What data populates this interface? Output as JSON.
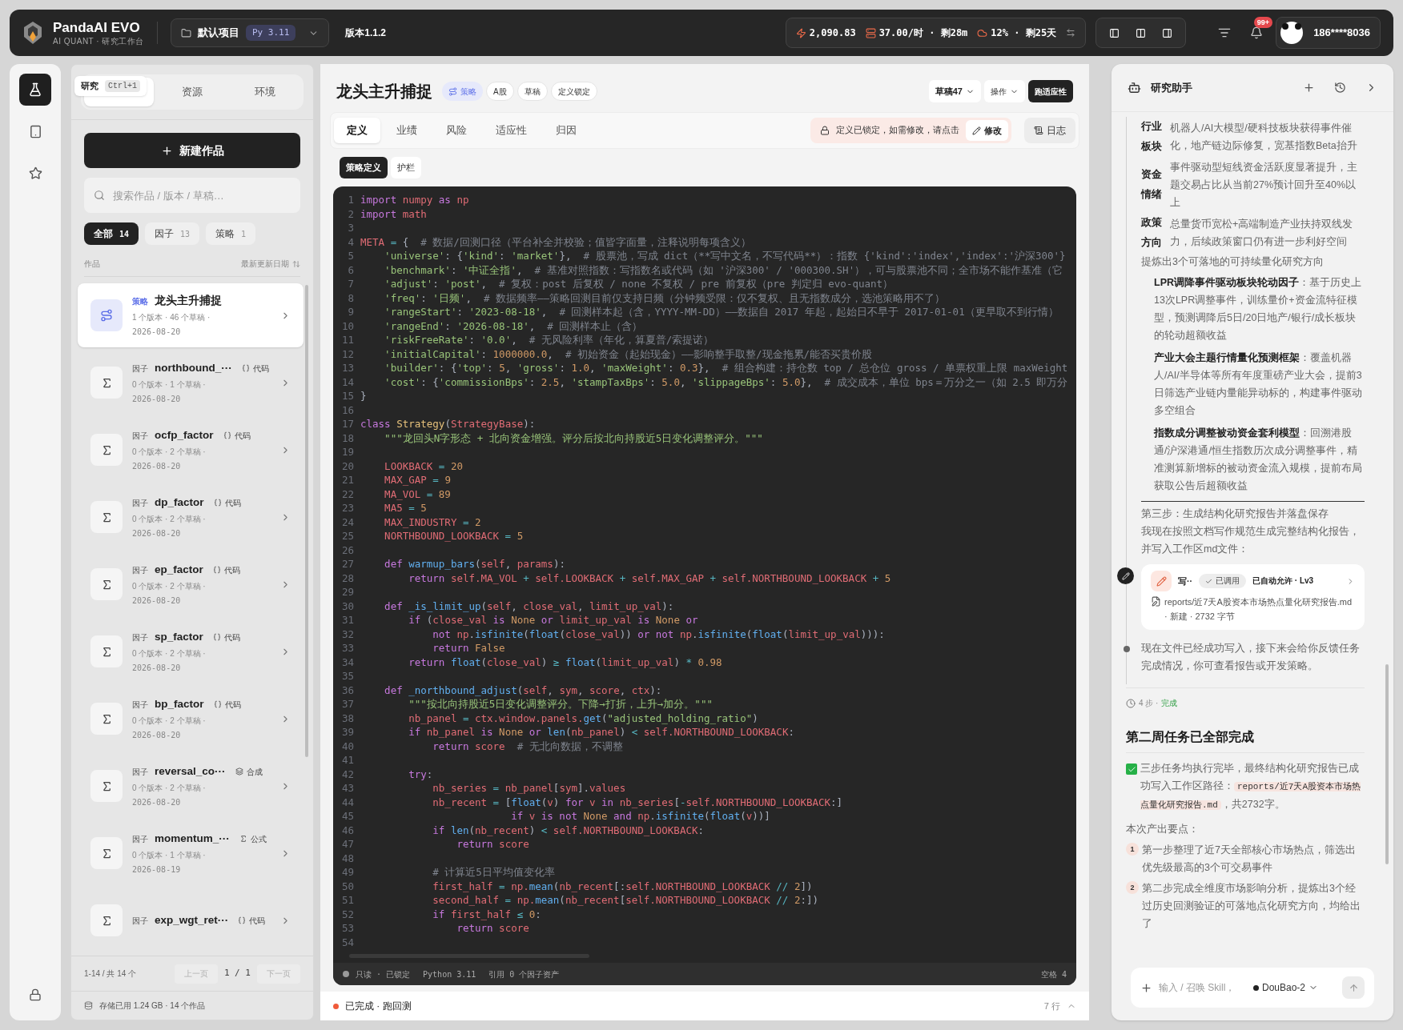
{
  "topbar": {
    "brand": "PandaAI EVO",
    "subtitle": "AI QUANT · 研究工作台",
    "project": "默认项目",
    "python": "Py 3.11",
    "version": "版本1.1.2",
    "stats": [
      {
        "kind": "points",
        "text": "2,090.83"
      },
      {
        "kind": "rate",
        "text": "37.00/时 · 剩28m"
      },
      {
        "kind": "quota",
        "text": "12% · 剩25天"
      }
    ],
    "notifications": "99+",
    "user": "186****8036"
  },
  "rail": [
    {
      "kind": "research",
      "selected": true
    },
    {
      "kind": "notes",
      "selected": false
    },
    {
      "kind": "favorites",
      "selected": false
    }
  ],
  "sidebar": {
    "tooltip": {
      "label": "研究",
      "shortcut": "Ctrl+1"
    },
    "tabs": [
      {
        "selected": true
      },
      {
        "label": "资源",
        "selected": false
      },
      {
        "label": "环境",
        "selected": false
      }
    ],
    "new_button": "新建作品",
    "search": {
      "placeholder": "搜索作品 / 版本 / 草稿…"
    },
    "filters": [
      {
        "label": "全部",
        "count": "14",
        "selected": true
      },
      {
        "label": "因子",
        "count": "13",
        "selected": false
      },
      {
        "label": "策略",
        "count": "1",
        "selected": false
      }
    ],
    "list_header": {
      "left": "作品",
      "right": "最新更新日期"
    },
    "items": [
      {
        "kind": "strategy",
        "type": "策略",
        "name": "龙头主升捕捉",
        "meta": "1 个版本 · 46 个草稿 ·",
        "date": "2026-08-20",
        "selected": true
      },
      {
        "kind": "factor",
        "type": "因子",
        "name": "northbound_···",
        "tag": {
          "kind": "code",
          "label": "代码"
        },
        "meta": "0 个版本 · 1 个草稿 ·",
        "date": "2026-08-20",
        "selected": false
      },
      {
        "kind": "factor",
        "type": "因子",
        "name": "ocfp_factor",
        "tag": {
          "kind": "code",
          "label": "代码"
        },
        "meta": "0 个版本 · 2 个草稿 ·",
        "date": "2026-08-20",
        "selected": false
      },
      {
        "kind": "factor",
        "type": "因子",
        "name": "dp_factor",
        "tag": {
          "kind": "code",
          "label": "代码"
        },
        "meta": "0 个版本 · 2 个草稿 ·",
        "date": "2026-08-20",
        "selected": false
      },
      {
        "kind": "factor",
        "type": "因子",
        "name": "ep_factor",
        "tag": {
          "kind": "code",
          "label": "代码"
        },
        "meta": "0 个版本 · 2 个草稿 ·",
        "date": "2026-08-20",
        "selected": false
      },
      {
        "kind": "factor",
        "type": "因子",
        "name": "sp_factor",
        "tag": {
          "kind": "code",
          "label": "代码"
        },
        "meta": "0 个版本 · 2 个草稿 ·",
        "date": "2026-08-20",
        "selected": false
      },
      {
        "kind": "factor",
        "type": "因子",
        "name": "bp_factor",
        "tag": {
          "kind": "code",
          "label": "代码"
        },
        "meta": "0 个版本 · 2 个草稿 ·",
        "date": "2026-08-20",
        "selected": false
      },
      {
        "kind": "factor",
        "type": "因子",
        "name": "reversal_co···",
        "tag": {
          "kind": "composite",
          "label": "合成"
        },
        "meta": "0 个版本 · 2 个草稿 ·",
        "date": "2026-08-20",
        "selected": false
      },
      {
        "kind": "factor",
        "type": "因子",
        "name": "momentum_···",
        "tag": {
          "kind": "formula",
          "label": "公式"
        },
        "meta": "0 个版本 · 1 个草稿 ·",
        "date": "2026-08-19",
        "selected": false
      },
      {
        "kind": "factor",
        "type": "因子",
        "name": "exp_wgt_ret···",
        "tag": {
          "kind": "code",
          "label": "代码"
        },
        "selected": false
      }
    ],
    "pagination": {
      "range": "1-14 / 共 14 个",
      "prev": {
        "label": "上一页",
        "disabled": true
      },
      "page": "1",
      "separator": "/",
      "pages": "1",
      "next": {
        "label": "下一页",
        "disabled": true
      }
    },
    "storage": "存储已用 1.24 GB · 14 个作品"
  },
  "work": {
    "title": "龙头主升捕捉",
    "tags": [
      {
        "kind": "strategy",
        "label": "策略"
      },
      {
        "kind": "plain",
        "label": "A股"
      },
      {
        "kind": "plain",
        "label": "草稿"
      },
      {
        "kind": "plain",
        "label": "定义锁定"
      }
    ],
    "draft": "草稿47",
    "actions": "操作",
    "run": "跑适应性",
    "tabs": [
      {
        "label": "定义",
        "selected": true
      },
      {
        "label": "业绩",
        "selected": false
      },
      {
        "label": "风险",
        "selected": false
      },
      {
        "label": "适应性",
        "selected": false
      },
      {
        "label": "归因",
        "selected": false
      }
    ],
    "lock_notice": "定义已锁定，如需修改，请点击",
    "edit": "修改",
    "log": "日志",
    "subtabs": [
      {
        "label": "策略定义",
        "selected": true
      },
      {
        "label": "护栏",
        "selected": false
      }
    ],
    "code": [
      {
        "number": "1",
        "segments": [
          {
            "kind": "kw",
            "text": "import"
          },
          {
            "kind": "var",
            "text": " numpy "
          },
          {
            "kind": "kw",
            "text": "as"
          },
          {
            "kind": "var",
            "text": " np"
          }
        ]
      },
      {
        "number": "2",
        "segments": [
          {
            "kind": "kw",
            "text": "import"
          },
          {
            "kind": "var",
            "text": " math"
          }
        ]
      },
      {
        "number": "3"
      },
      {
        "number": "4",
        "segments": [
          {
            "kind": "var",
            "text": "META"
          },
          {
            "kind": "op",
            "text": " = "
          },
          {
            "kind": "plain",
            "text": "{  "
          },
          {
            "kind": "com",
            "text": "# 数据/回测口径（平台补全并校验；值皆字面量，注释说明每项含义）"
          }
        ]
      },
      {
        "number": "5",
        "segments": [
          {
            "kind": "str",
            "text": "    'universe'"
          },
          {
            "kind": "plain",
            "text": ": {"
          },
          {
            "kind": "str",
            "text": "'kind'"
          },
          {
            "kind": "plain",
            "text": ": "
          },
          {
            "kind": "str",
            "text": "'market'"
          },
          {
            "kind": "plain",
            "text": "},  "
          },
          {
            "kind": "com",
            "text": "# 股票池，写成 dict（**写中文名，不写代码**）：指数 {'kind':'index','index':'沪深300'}"
          }
        ]
      },
      {
        "number": "6",
        "segments": [
          {
            "kind": "str",
            "text": "    'benchmark'"
          },
          {
            "kind": "plain",
            "text": ": "
          },
          {
            "kind": "str",
            "text": "'中证全指'"
          },
          {
            "kind": "plain",
            "text": ",  "
          },
          {
            "kind": "com",
            "text": "# 基准对照指数：写指数名或代码（如 '沪深300' / '000300.SH'），可与股票池不同；全市场不能作基准（它"
          }
        ]
      },
      {
        "number": "7",
        "segments": [
          {
            "kind": "str",
            "text": "    'adjust'"
          },
          {
            "kind": "plain",
            "text": ": "
          },
          {
            "kind": "str",
            "text": "'post'"
          },
          {
            "kind": "plain",
            "text": ",  "
          },
          {
            "kind": "com",
            "text": "# 复权：post 后复权 / none 不复权 / pre 前复权（pre 判定归 evo-quant）"
          }
        ]
      },
      {
        "number": "8",
        "segments": [
          {
            "kind": "str",
            "text": "    'freq'"
          },
          {
            "kind": "plain",
            "text": ": "
          },
          {
            "kind": "str",
            "text": "'日频'"
          },
          {
            "kind": "plain",
            "text": ",  "
          },
          {
            "kind": "com",
            "text": "# 数据频率——策略回测目前仅支持日频（分钟频受限：仅不复权、且无指数成分，选池策略用不了）"
          }
        ]
      },
      {
        "number": "9",
        "segments": [
          {
            "kind": "str",
            "text": "    'rangeStart'"
          },
          {
            "kind": "plain",
            "text": ": "
          },
          {
            "kind": "str",
            "text": "'2023-08-18'"
          },
          {
            "kind": "plain",
            "text": ",  "
          },
          {
            "kind": "com",
            "text": "# 回测样本起（含，YYYY-MM-DD）——数据自 2017 年起，起始日不早于 2017-01-01（更早取不到行情）"
          }
        ]
      },
      {
        "number": "10",
        "segments": [
          {
            "kind": "str",
            "text": "    'rangeEnd'"
          },
          {
            "kind": "plain",
            "text": ": "
          },
          {
            "kind": "str",
            "text": "'2026-08-18'"
          },
          {
            "kind": "plain",
            "text": ",  "
          },
          {
            "kind": "com",
            "text": "# 回测样本止（含）"
          }
        ]
      },
      {
        "number": "11",
        "segments": [
          {
            "kind": "str",
            "text": "    'riskFreeRate'"
          },
          {
            "kind": "plain",
            "text": ": "
          },
          {
            "kind": "str",
            "text": "'0.0'"
          },
          {
            "kind": "plain",
            "text": ",  "
          },
          {
            "kind": "com",
            "text": "# 无风险利率（年化，算夏普/索提诺）"
          }
        ]
      },
      {
        "number": "12",
        "segments": [
          {
            "kind": "str",
            "text": "    'initialCapital'"
          },
          {
            "kind": "plain",
            "text": ": "
          },
          {
            "kind": "num",
            "text": "1000000.0"
          },
          {
            "kind": "plain",
            "text": ",  "
          },
          {
            "kind": "com",
            "text": "# 初始资金（起始现金）——影响整手取整/现金拖累/能否买贵价股"
          }
        ]
      },
      {
        "number": "13",
        "segments": [
          {
            "kind": "str",
            "text": "    'builder'"
          },
          {
            "kind": "plain",
            "text": ": {"
          },
          {
            "kind": "str",
            "text": "'top'"
          },
          {
            "kind": "plain",
            "text": ": "
          },
          {
            "kind": "num",
            "text": "5"
          },
          {
            "kind": "plain",
            "text": ", "
          },
          {
            "kind": "str",
            "text": "'gross'"
          },
          {
            "kind": "plain",
            "text": ": "
          },
          {
            "kind": "num",
            "text": "1.0"
          },
          {
            "kind": "plain",
            "text": ", "
          },
          {
            "kind": "str",
            "text": "'maxWeight'"
          },
          {
            "kind": "plain",
            "text": ": "
          },
          {
            "kind": "num",
            "text": "0.3"
          },
          {
            "kind": "plain",
            "text": "},  "
          },
          {
            "kind": "com",
            "text": "# 组合构建：持仓数 top / 总仓位 gross / 单票权重上限 maxWeight"
          }
        ]
      },
      {
        "number": "14",
        "segments": [
          {
            "kind": "str",
            "text": "    'cost'"
          },
          {
            "kind": "plain",
            "text": ": {"
          },
          {
            "kind": "str",
            "text": "'commissionBps'"
          },
          {
            "kind": "plain",
            "text": ": "
          },
          {
            "kind": "num",
            "text": "2.5"
          },
          {
            "kind": "plain",
            "text": ", "
          },
          {
            "kind": "str",
            "text": "'stampTaxBps'"
          },
          {
            "kind": "plain",
            "text": ": "
          },
          {
            "kind": "num",
            "text": "5.0"
          },
          {
            "kind": "plain",
            "text": ", "
          },
          {
            "kind": "str",
            "text": "'slippageBps'"
          },
          {
            "kind": "plain",
            "text": ": "
          },
          {
            "kind": "num",
            "text": "5.0"
          },
          {
            "kind": "plain",
            "text": "},  "
          },
          {
            "kind": "com",
            "text": "# 成交成本，单位 bps＝万分之一（如 2.5 即万分"
          }
        ]
      },
      {
        "number": "15",
        "segments": [
          {
            "kind": "plain",
            "text": "}"
          }
        ]
      },
      {
        "number": "16"
      },
      {
        "number": "17",
        "segments": [
          {
            "kind": "kw",
            "text": "class "
          },
          {
            "kind": "cls",
            "text": "Strategy"
          },
          {
            "kind": "plain",
            "text": "("
          },
          {
            "kind": "var",
            "text": "StrategyBase"
          },
          {
            "kind": "plain",
            "text": "):"
          }
        ]
      },
      {
        "number": "18",
        "segments": [
          {
            "kind": "str",
            "text": "    \"\"\"龙回头N字形态 + 北向资金增强。评分后按北向持股近5日变化调整评分。\"\"\""
          }
        ]
      },
      {
        "number": "19"
      },
      {
        "number": "20",
        "segments": [
          {
            "kind": "var",
            "text": "    LOOKBACK"
          },
          {
            "kind": "op",
            "text": " = "
          },
          {
            "kind": "num",
            "text": "20"
          }
        ]
      },
      {
        "number": "21",
        "segments": [
          {
            "kind": "var",
            "text": "    MAX_GAP"
          },
          {
            "kind": "op",
            "text": " = "
          },
          {
            "kind": "num",
            "text": "9"
          }
        ]
      },
      {
        "number": "22",
        "segments": [
          {
            "kind": "var",
            "text": "    MA_VOL"
          },
          {
            "kind": "op",
            "text": " = "
          },
          {
            "kind": "num",
            "text": "89"
          }
        ]
      },
      {
        "number": "23",
        "segments": [
          {
            "kind": "var",
            "text": "    MA5"
          },
          {
            "kind": "op",
            "text": " = "
          },
          {
            "kind": "num",
            "text": "5"
          }
        ]
      },
      {
        "number": "24",
        "segments": [
          {
            "kind": "var",
            "text": "    MAX_INDUSTRY"
          },
          {
            "kind": "op",
            "text": " = "
          },
          {
            "kind": "num",
            "text": "2"
          }
        ]
      },
      {
        "number": "25",
        "segments": [
          {
            "kind": "var",
            "text": "    NORTHBOUND_LOOKBACK"
          },
          {
            "kind": "op",
            "text": " = "
          },
          {
            "kind": "num",
            "text": "5"
          }
        ]
      },
      {
        "number": "26"
      },
      {
        "number": "27",
        "segments": [
          {
            "kind": "kw",
            "text": "    def "
          },
          {
            "kind": "fn",
            "text": "warmup_bars"
          },
          {
            "kind": "plain",
            "text": "("
          },
          {
            "kind": "var",
            "text": "self"
          },
          {
            "kind": "plain",
            "text": ", "
          },
          {
            "kind": "var",
            "text": "params"
          },
          {
            "kind": "plain",
            "text": "):"
          }
        ]
      },
      {
        "number": "28",
        "segments": [
          {
            "kind": "kw",
            "text": "        return"
          },
          {
            "kind": "var",
            "text": " self.MA_VOL "
          },
          {
            "kind": "op",
            "text": "+"
          },
          {
            "kind": "var",
            "text": " self.LOOKBACK "
          },
          {
            "kind": "op",
            "text": "+"
          },
          {
            "kind": "var",
            "text": " self.MAX_GAP "
          },
          {
            "kind": "op",
            "text": "+"
          },
          {
            "kind": "var",
            "text": " self.NORTHBOUND_LOOKBACK "
          },
          {
            "kind": "op",
            "text": "+"
          },
          {
            "kind": "num",
            "text": " 5"
          }
        ]
      },
      {
        "number": "29"
      },
      {
        "number": "30",
        "segments": [
          {
            "kind": "kw",
            "text": "    def "
          },
          {
            "kind": "fn",
            "text": "_is_limit_up"
          },
          {
            "kind": "plain",
            "text": "("
          },
          {
            "kind": "var",
            "text": "self"
          },
          {
            "kind": "plain",
            "text": ", "
          },
          {
            "kind": "var",
            "text": "close_val"
          },
          {
            "kind": "plain",
            "text": ", "
          },
          {
            "kind": "var",
            "text": "limit_up_val"
          },
          {
            "kind": "plain",
            "text": "):"
          }
        ]
      },
      {
        "number": "31",
        "segments": [
          {
            "kind": "kw",
            "text": "        if"
          },
          {
            "kind": "plain",
            "text": " ("
          },
          {
            "kind": "var",
            "text": "close_val "
          },
          {
            "kind": "kw",
            "text": "is"
          },
          {
            "kind": "num",
            "text": " None "
          },
          {
            "kind": "kw",
            "text": "or"
          },
          {
            "kind": "var",
            "text": " limit_up_val "
          },
          {
            "kind": "kw",
            "text": "is"
          },
          {
            "kind": "num",
            "text": " None "
          },
          {
            "kind": "kw",
            "text": "or"
          }
        ]
      },
      {
        "number": "32",
        "segments": [
          {
            "kind": "kw",
            "text": "            not"
          },
          {
            "kind": "var",
            "text": " np"
          },
          {
            "kind": "plain",
            "text": "."
          },
          {
            "kind": "fn",
            "text": "isfinite"
          },
          {
            "kind": "plain",
            "text": "("
          },
          {
            "kind": "fn",
            "text": "float"
          },
          {
            "kind": "plain",
            "text": "("
          },
          {
            "kind": "var",
            "text": "close_val"
          },
          {
            "kind": "plain",
            "text": ")) "
          },
          {
            "kind": "kw",
            "text": "or not"
          },
          {
            "kind": "var",
            "text": " np"
          },
          {
            "kind": "plain",
            "text": "."
          },
          {
            "kind": "fn",
            "text": "isfinite"
          },
          {
            "kind": "plain",
            "text": "("
          },
          {
            "kind": "fn",
            "text": "float"
          },
          {
            "kind": "plain",
            "text": "("
          },
          {
            "kind": "var",
            "text": "limit_up_val"
          },
          {
            "kind": "plain",
            "text": "))):"
          }
        ]
      },
      {
        "number": "33",
        "segments": [
          {
            "kind": "kw",
            "text": "            return"
          },
          {
            "kind": "num",
            "text": " False"
          }
        ]
      },
      {
        "number": "34",
        "segments": [
          {
            "kind": "kw",
            "text": "        return"
          },
          {
            "kind": "fn",
            "text": " float"
          },
          {
            "kind": "plain",
            "text": "("
          },
          {
            "kind": "var",
            "text": "close_val"
          },
          {
            "kind": "plain",
            "text": ") "
          },
          {
            "kind": "op",
            "text": "≥"
          },
          {
            "kind": "fn",
            "text": " float"
          },
          {
            "kind": "plain",
            "text": "("
          },
          {
            "kind": "var",
            "text": "limit_up_val"
          },
          {
            "kind": "plain",
            "text": ") "
          },
          {
            "kind": "op",
            "text": "*"
          },
          {
            "kind": "num",
            "text": " 0.98"
          }
        ]
      },
      {
        "number": "35"
      },
      {
        "number": "36",
        "segments": [
          {
            "kind": "kw",
            "text": "    def "
          },
          {
            "kind": "fn",
            "text": "_northbound_adjust"
          },
          {
            "kind": "plain",
            "text": "("
          },
          {
            "kind": "var",
            "text": "self"
          },
          {
            "kind": "plain",
            "text": ", "
          },
          {
            "kind": "var",
            "text": "sym"
          },
          {
            "kind": "plain",
            "text": ", "
          },
          {
            "kind": "var",
            "text": "score"
          },
          {
            "kind": "plain",
            "text": ", "
          },
          {
            "kind": "var",
            "text": "ctx"
          },
          {
            "kind": "plain",
            "text": "):"
          }
        ]
      },
      {
        "number": "37",
        "segments": [
          {
            "kind": "str",
            "text": "        \"\"\"按北向持股近5日变化调整评分。下降→打折，上升→加分。\"\"\""
          }
        ]
      },
      {
        "number": "38",
        "segments": [
          {
            "kind": "var",
            "text": "        nb_panel"
          },
          {
            "kind": "op",
            "text": " = "
          },
          {
            "kind": "var",
            "text": "ctx.window.panels."
          },
          {
            "kind": "fn",
            "text": "get"
          },
          {
            "kind": "plain",
            "text": "("
          },
          {
            "kind": "str",
            "text": "\"adjusted_holding_ratio\""
          },
          {
            "kind": "plain",
            "text": ")"
          }
        ]
      },
      {
        "number": "39",
        "segments": [
          {
            "kind": "kw",
            "text": "        if"
          },
          {
            "kind": "var",
            "text": " nb_panel "
          },
          {
            "kind": "kw",
            "text": "is"
          },
          {
            "kind": "num",
            "text": " None "
          },
          {
            "kind": "kw",
            "text": "or"
          },
          {
            "kind": "fn",
            "text": " len"
          },
          {
            "kind": "plain",
            "text": "("
          },
          {
            "kind": "var",
            "text": "nb_panel"
          },
          {
            "kind": "plain",
            "text": ") "
          },
          {
            "kind": "op",
            "text": "<"
          },
          {
            "kind": "var",
            "text": " self.NORTHBOUND_LOOKBACK"
          },
          {
            "kind": "plain",
            "text": ":"
          }
        ]
      },
      {
        "number": "40",
        "segments": [
          {
            "kind": "kw",
            "text": "            return"
          },
          {
            "kind": "var",
            "text": " score  "
          },
          {
            "kind": "com",
            "text": "# 无北向数据，不调整"
          }
        ]
      },
      {
        "number": "41"
      },
      {
        "number": "42",
        "segments": [
          {
            "kind": "kw",
            "text": "        try"
          },
          {
            "kind": "plain",
            "text": ":"
          }
        ]
      },
      {
        "number": "43",
        "segments": [
          {
            "kind": "var",
            "text": "            nb_series"
          },
          {
            "kind": "op",
            "text": " = "
          },
          {
            "kind": "var",
            "text": "nb_panel"
          },
          {
            "kind": "plain",
            "text": "["
          },
          {
            "kind": "var",
            "text": "sym"
          },
          {
            "kind": "plain",
            "text": "]."
          },
          {
            "kind": "var",
            "text": "values"
          }
        ]
      },
      {
        "number": "44",
        "segments": [
          {
            "kind": "var",
            "text": "            nb_recent"
          },
          {
            "kind": "op",
            "text": " = "
          },
          {
            "kind": "plain",
            "text": "["
          },
          {
            "kind": "fn",
            "text": "float"
          },
          {
            "kind": "plain",
            "text": "("
          },
          {
            "kind": "var",
            "text": "v"
          },
          {
            "kind": "plain",
            "text": ") "
          },
          {
            "kind": "kw",
            "text": "for"
          },
          {
            "kind": "var",
            "text": " v "
          },
          {
            "kind": "kw",
            "text": "in"
          },
          {
            "kind": "var",
            "text": " nb_series"
          },
          {
            "kind": "plain",
            "text": "["
          },
          {
            "kind": "op",
            "text": "-"
          },
          {
            "kind": "var",
            "text": "self.NORTHBOUND_LOOKBACK"
          },
          {
            "kind": "plain",
            "text": ":]"
          }
        ]
      },
      {
        "number": "45",
        "segments": [
          {
            "kind": "kw",
            "text": "                         if"
          },
          {
            "kind": "var",
            "text": " v "
          },
          {
            "kind": "kw",
            "text": "is not"
          },
          {
            "kind": "num",
            "text": " None "
          },
          {
            "kind": "kw",
            "text": "and"
          },
          {
            "kind": "var",
            "text": " np"
          },
          {
            "kind": "plain",
            "text": "."
          },
          {
            "kind": "fn",
            "text": "isfinite"
          },
          {
            "kind": "plain",
            "text": "("
          },
          {
            "kind": "fn",
            "text": "float"
          },
          {
            "kind": "plain",
            "text": "("
          },
          {
            "kind": "var",
            "text": "v"
          },
          {
            "kind": "plain",
            "text": "))]"
          }
        ]
      },
      {
        "number": "46",
        "segments": [
          {
            "kind": "kw",
            "text": "            if"
          },
          {
            "kind": "fn",
            "text": " len"
          },
          {
            "kind": "plain",
            "text": "("
          },
          {
            "kind": "var",
            "text": "nb_recent"
          },
          {
            "kind": "plain",
            "text": ") "
          },
          {
            "kind": "op",
            "text": "<"
          },
          {
            "kind": "var",
            "text": " self.NORTHBOUND_LOOKBACK"
          },
          {
            "kind": "plain",
            "text": ":"
          }
        ]
      },
      {
        "number": "47",
        "segments": [
          {
            "kind": "kw",
            "text": "                return"
          },
          {
            "kind": "var",
            "text": " score"
          }
        ]
      },
      {
        "number": "48"
      },
      {
        "number": "49",
        "segments": [
          {
            "kind": "com",
            "text": "            # 计算近5日平均值变化率"
          }
        ]
      },
      {
        "number": "50",
        "segments": [
          {
            "kind": "var",
            "text": "            first_half"
          },
          {
            "kind": "op",
            "text": " = "
          },
          {
            "kind": "var",
            "text": "np."
          },
          {
            "kind": "fn",
            "text": "mean"
          },
          {
            "kind": "plain",
            "text": "("
          },
          {
            "kind": "var",
            "text": "nb_recent"
          },
          {
            "kind": "plain",
            "text": "[:"
          },
          {
            "kind": "var",
            "text": "self.NORTHBOUND_LOOKBACK "
          },
          {
            "kind": "op",
            "text": "//"
          },
          {
            "kind": "num",
            "text": " 2"
          },
          {
            "kind": "plain",
            "text": "])"
          }
        ]
      },
      {
        "number": "51",
        "segments": [
          {
            "kind": "var",
            "text": "            second_half"
          },
          {
            "kind": "op",
            "text": " = "
          },
          {
            "kind": "var",
            "text": "np."
          },
          {
            "kind": "fn",
            "text": "mean"
          },
          {
            "kind": "plain",
            "text": "("
          },
          {
            "kind": "var",
            "text": "nb_recent"
          },
          {
            "kind": "plain",
            "text": "["
          },
          {
            "kind": "var",
            "text": "self.NORTHBOUND_LOOKBACK "
          },
          {
            "kind": "op",
            "text": "//"
          },
          {
            "kind": "num",
            "text": " 2"
          },
          {
            "kind": "plain",
            "text": ":])"
          }
        ]
      },
      {
        "number": "52",
        "segments": [
          {
            "kind": "kw",
            "text": "            if"
          },
          {
            "kind": "var",
            "text": " first_half "
          },
          {
            "kind": "op",
            "text": "≤"
          },
          {
            "kind": "num",
            "text": " 0"
          },
          {
            "kind": "plain",
            "text": ":"
          }
        ]
      },
      {
        "number": "53",
        "segments": [
          {
            "kind": "kw",
            "text": "                return"
          },
          {
            "kind": "var",
            "text": " score"
          }
        ]
      },
      {
        "number": "54"
      }
    ],
    "status": {
      "mode": "只读 · 已锁定",
      "language": "Python 3.11",
      "refs": "引用 0 个因子资产",
      "indent": "空格 4"
    },
    "run_bar": {
      "state": "已完成 · 跑回测",
      "lines": "7 行"
    }
  },
  "assistant": {
    "title": "研究助手",
    "facts": [
      {
        "term": "行业板块",
        "text": "机器人/AI大模型/硬科技板块获得事件催化，地产链边际修复，宽基指数Beta抬升"
      },
      {
        "term": "资金情绪",
        "text": "事件驱动型短线资金活跃度显著提升，主题交易占比从当前27%预计回升至40%以上"
      },
      {
        "term": "政策方向",
        "text": "总量货币宽松+高端制造产业扶持双线发力，后续政策窗口仍有进一步利好空间"
      }
    ],
    "summary": "提炼出3个可落地的可持续量化研究方向",
    "directions": [
      "**LPR调降事件驱动板块轮动因子**：基于历史上13次LPR调整事件，训练量价+资金流特征模型，预测调降后5日/20日地产/银行/成长板块的轮动超额收益",
      "**产业大会主题行情量化预测框架**：覆盖机器人/AI/半导体等所有年度重磅产业大会，提前3日筛选产业链内量能异动标的，构建事件驱动多空组合",
      "**指数成分调整被动资金套利模型**：回溯港股通/沪深港通/恒生指数历次成分调整事件，精准测算新增标的被动资金流入规模，提前布局获取公告后超额收益"
    ],
    "step": "第三步：生成结构化研究报告并落盘保存",
    "step_text": "我现在按照文档写作规范生成完整结构化报告，并写入工作区md文件：",
    "tool_call": {
      "title": "写··",
      "status": "已调用",
      "permission": "已自动允许 · Lv3",
      "file": "reports/近7天A股资本市场热点量化研究报告.md · 新建 · 2732 字节"
    },
    "progress_text": "现在文件已经成功写入，接下来会给你反馈任务完成情况，你可查看报告或开发策略。",
    "steps_count": "4 步 ·",
    "steps_state": "完成",
    "heading": "第二周任务已全部完成",
    "result": {
      "before": "三步任务均执行完毕，最终结构化研究报告已成功写入工作区路径：",
      "code": "reports/近7天A股资本市场热点量化研究报告.md",
      "after": "，共2732字。"
    },
    "points_title": "本次产出要点：",
    "points": [
      {
        "number": "1",
        "text": "第一步整理了近7天全部核心市场热点，筛选出优先级最高的3个可交易事件"
      },
      {
        "number": "2",
        "text": "第二步完成全维度市场影响分析，提炼出3个经过历史回测验证的可落地点化研究方向，均给出了"
      }
    ],
    "composer": {
      "placeholder": "输入 / 召唤 Skill，",
      "model": "DouBao-2"
    }
  }
}
